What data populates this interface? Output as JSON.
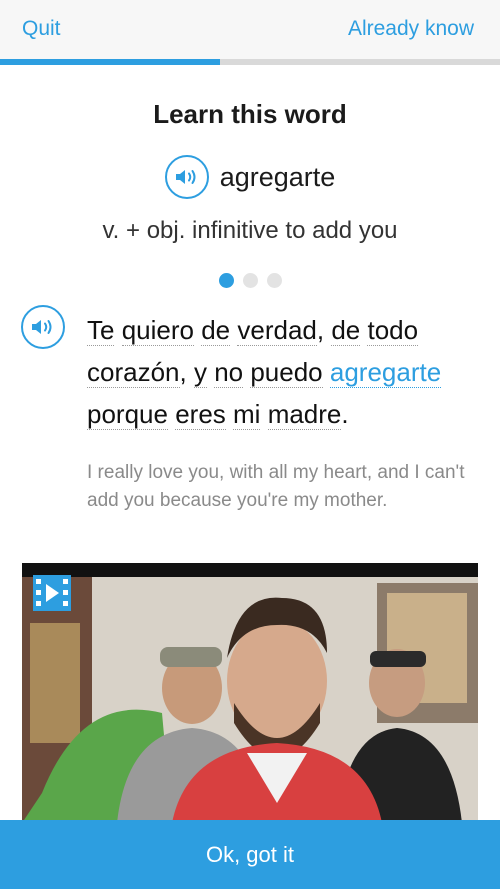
{
  "header": {
    "quit_label": "Quit",
    "already_know_label": "Already know"
  },
  "progress": {
    "fraction": 0.44
  },
  "card": {
    "heading": "Learn this word",
    "word": "agregarte",
    "definition": "v. + obj. infinitive to add you",
    "example_dots": {
      "total": 3,
      "active_index": 0
    },
    "sentence": {
      "words": [
        {
          "text": "Te",
          "link": true
        },
        {
          "text": " "
        },
        {
          "text": "quiero",
          "link": true
        },
        {
          "text": " "
        },
        {
          "text": "de",
          "link": true
        },
        {
          "text": " "
        },
        {
          "text": "verdad",
          "link": true
        },
        {
          "text": ", "
        },
        {
          "text": "de",
          "link": true
        },
        {
          "text": " "
        },
        {
          "text": "todo",
          "link": true
        },
        {
          "text": " "
        },
        {
          "text": "corazón",
          "link": true
        },
        {
          "text": ", "
        },
        {
          "text": "y",
          "link": true
        },
        {
          "text": " "
        },
        {
          "text": "no",
          "link": true
        },
        {
          "text": " "
        },
        {
          "text": "puedo",
          "link": true
        },
        {
          "text": " "
        },
        {
          "text": "agregarte",
          "link": true,
          "highlight": true
        },
        {
          "text": " "
        },
        {
          "text": "porque",
          "link": true
        },
        {
          "text": " "
        },
        {
          "text": "eres",
          "link": true
        },
        {
          "text": " "
        },
        {
          "text": "mi",
          "link": true
        },
        {
          "text": " "
        },
        {
          "text": "madre",
          "link": true
        },
        {
          "text": "."
        }
      ]
    },
    "translation": "I really love you, with all my heart, and I can't add you because you're my mother."
  },
  "media": {
    "video_icon": "film-play-icon",
    "speaker_icon": "speaker-icon"
  },
  "footer": {
    "ok_label": "Ok, got it"
  },
  "colors": {
    "accent": "#2d9ee0",
    "track": "#d9d9d9",
    "muted_text": "#8a8a8a"
  }
}
